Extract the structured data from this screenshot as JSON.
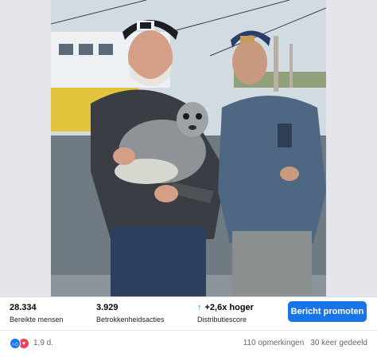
{
  "insights": {
    "reach_value": "28.334",
    "reach_label": "Bereikte mensen",
    "engagement_value": "3.929",
    "engagement_label": "Betrokkenheidsacties",
    "score_value": "+2,6x hoger",
    "score_label": "Distributiescore"
  },
  "promote_button": "Bericht promoten",
  "engagement": {
    "reaction_count": "1,9 d.",
    "comments": "110 opmerkingen",
    "shares": "30 keer gedeeld"
  },
  "colors": {
    "primary": "#1b74e4",
    "positive": "#31a24c",
    "like": "#1877f2",
    "love": "#f33e58"
  },
  "icons": {
    "score": "up-arrow-icon",
    "like": "like-icon",
    "love": "love-icon"
  }
}
